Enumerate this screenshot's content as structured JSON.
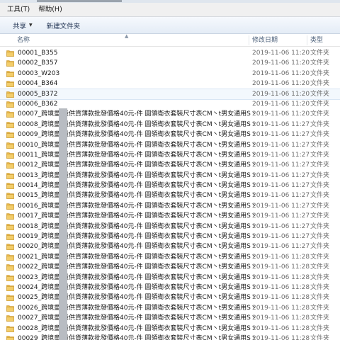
{
  "menu": {
    "tools": "工具(T)",
    "help": "帮助(H)"
  },
  "toolbar": {
    "share": "共享",
    "new_folder": "新建文件夹"
  },
  "columns": {
    "name": "名称",
    "date": "修改日期",
    "type": "类型"
  },
  "icons": {
    "folder_color": "#e8b84a"
  },
  "files": [
    {
      "name": "00001_B355",
      "date": "2019-11-06 11:20",
      "type": "文件夹"
    },
    {
      "name": "00002_B357",
      "date": "2019-11-06 11:20",
      "type": "文件夹"
    },
    {
      "name": "00003_W203",
      "date": "2019-11-06 11:20",
      "type": "文件夹"
    },
    {
      "name": "00004_B364",
      "date": "2019-11-06 11:20",
      "type": "文件夹"
    },
    {
      "name": "00005_B372",
      "date": "2019-11-06 11:20",
      "type": "文件夹"
    },
    {
      "name": "00006_B362",
      "date": "2019-11-06 11:20",
      "type": "文件夹"
    },
    {
      "name": "00007_跨境童    量供貨薄款批發價格40元-件 圓領衛衣套裝尺寸表CM丶t男女通用S丶",
      "date": "2019-11-06 11:20",
      "type": "文件夹"
    },
    {
      "name": "00008_跨境童    量供貨薄款批發價格40元-件 圓領衛衣套裝尺寸表CM丶t男女通用S丶",
      "date": "2019-11-06 11:27",
      "type": "文件夹"
    },
    {
      "name": "00009_跨境童    量供貨薄款批發價格40元-件 圓領衛衣套裝尺寸表CM丶t男女通用S丶",
      "date": "2019-11-06 11:27",
      "type": "文件夹"
    },
    {
      "name": "00010_跨境童    量供貨薄款批發價格40元-件 圓領衛衣套裝尺寸表CM丶t男女通用S丶",
      "date": "2019-11-06 11:27",
      "type": "文件夹"
    },
    {
      "name": "00011_跨境童    量供貨薄款批發價格40元-件 圓領衛衣套裝尺寸表CM丶t男女通用S丶",
      "date": "2019-11-06 11:27",
      "type": "文件夹"
    },
    {
      "name": "00012_跨境童    量供貨薄款批發價格40元-件 圓領衛衣套裝尺寸表CM丶t男女通用S丶",
      "date": "2019-11-06 11:27",
      "type": "文件夹"
    },
    {
      "name": "00013_跨境童    量供貨薄款批發價格40元-件 圓領衛衣套裝尺寸表CM丶t男女通用S丶",
      "date": "2019-11-06 11:27",
      "type": "文件夹"
    },
    {
      "name": "00014_跨境童    量供貨薄款批發價格40元-件 圓領衛衣套裝尺寸表CM丶t男女通用S丶",
      "date": "2019-11-06 11:27",
      "type": "文件夹"
    },
    {
      "name": "00015_跨境童    量供貨薄款批發價格40元-件 圓領衛衣套裝尺寸表CM丶t男女通用S丶",
      "date": "2019-11-06 11:27",
      "type": "文件夹"
    },
    {
      "name": "00016_跨境童    量供貨薄款批發價格40元-件 圓領衛衣套裝尺寸表CM丶t男女通用S丶",
      "date": "2019-11-06 11:27",
      "type": "文件夹"
    },
    {
      "name": "00017_跨境童    量供貨薄款批發價格40元-件 圓領衛衣套裝尺寸表CM丶t男女通用S丶",
      "date": "2019-11-06 11:27",
      "type": "文件夹"
    },
    {
      "name": "00018_跨境童    量供貨薄款批發價格40元-件 圓領衛衣套裝尺寸表CM丶t男女通用S丶",
      "date": "2019-11-06 11:27",
      "type": "文件夹"
    },
    {
      "name": "00019_跨境童    量供貨薄款批發價格40元-件 圓領衛衣套裝尺寸表CM丶t男女通用S丶",
      "date": "2019-11-06 11:27",
      "type": "文件夹"
    },
    {
      "name": "00020_跨境童    量供貨薄款批發價格40元-件 圓領衛衣套裝尺寸表CM丶t男女通用S丶",
      "date": "2019-11-06 11:27",
      "type": "文件夹"
    },
    {
      "name": "00021_跨境童    量供貨薄款批發價格40元-件 圓領衛衣套裝尺寸表CM丶t男女通用S丶",
      "date": "2019-11-06 11:28",
      "type": "文件夹"
    },
    {
      "name": "00022_跨境童    量供貨薄款批發價格40元-件 圓領衛衣套裝尺寸表CM丶t男女通用S丶",
      "date": "2019-11-06 11:28",
      "type": "文件夹"
    },
    {
      "name": "00023_跨境童    量供貨薄款批發價格40元-件 圓領衛衣套裝尺寸表CM丶t男女通用S丶",
      "date": "2019-11-06 11:28",
      "type": "文件夹"
    },
    {
      "name": "00024_跨境童    量供貨薄款批發價格40元-件 圓領衛衣套裝尺寸表CM丶t男女通用S丶",
      "date": "2019-11-06 11:28",
      "type": "文件夹"
    },
    {
      "name": "00025_跨境童    量供貨薄款批發價格40元-件 圓領衛衣套裝尺寸表CM丶t男女通用S丶",
      "date": "2019-11-06 11:28",
      "type": "文件夹"
    },
    {
      "name": "00026_跨境童    量供貨薄款批發價格40元-件 圓領衛衣套裝尺寸表CM丶t男女通用S丶",
      "date": "2019-11-06 11:28",
      "type": "文件夹"
    },
    {
      "name": "00027_跨境童    量供貨薄款批發價格40元-件 圓領衛衣套裝尺寸表CM丶t男女通用S丶",
      "date": "2019-11-06 11:28",
      "type": "文件夹"
    },
    {
      "name": "00028_跨境童    量供貨薄款批發價格40元-件 圓領衛衣套裝尺寸表CM丶t男女通用S丶",
      "date": "2019-11-06 11:28",
      "type": "文件夹"
    },
    {
      "name": "00029_跨境童    量供貨薄款批發價格40元-件 圓領衛衣套裝尺寸表CM丶t男女通用S丶",
      "date": "2019-11-06 11:28",
      "type": "文件夹"
    }
  ]
}
